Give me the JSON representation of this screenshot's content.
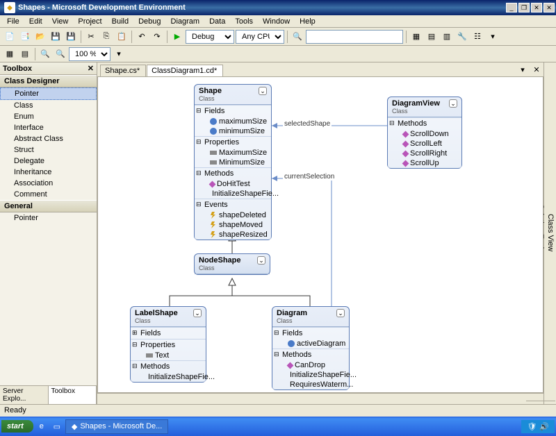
{
  "window": {
    "title": "Shapes - Microsoft Development Environment"
  },
  "menu": [
    "File",
    "Edit",
    "View",
    "Project",
    "Build",
    "Debug",
    "Diagram",
    "Data",
    "Tools",
    "Window",
    "Help"
  ],
  "toolbar": {
    "config": "Debug",
    "platform": "Any CPU",
    "zoom": "100 %"
  },
  "toolbox": {
    "title": "Toolbox",
    "sections": [
      {
        "name": "Class Designer",
        "items": [
          "Pointer",
          "Class",
          "Enum",
          "Interface",
          "Abstract Class",
          "Struct",
          "Delegate",
          "Inheritance",
          "Association",
          "Comment"
        ]
      },
      {
        "name": "General",
        "items": [
          "Pointer"
        ]
      }
    ],
    "tabs": [
      "Server Explo...",
      "Toolbox"
    ]
  },
  "tabs": [
    {
      "label": "Shape.cs*",
      "active": false
    },
    {
      "label": "ClassDiagram1.cd*",
      "active": true
    }
  ],
  "classes": {
    "shape": {
      "name": "Shape",
      "stereo": "Class",
      "sections": [
        {
          "title": "Fields",
          "kind": "field",
          "members": [
            "maximumSize",
            "minimumSize"
          ]
        },
        {
          "title": "Properties",
          "kind": "prop",
          "members": [
            "MaximumSize",
            "MinimumSize"
          ]
        },
        {
          "title": "Methods",
          "kind": "method",
          "members": [
            "DoHitTest",
            "InitializeShapeFie..."
          ]
        },
        {
          "title": "Events",
          "kind": "event",
          "members": [
            "shapeDeleted",
            "shapeMoved",
            "shapeResized"
          ]
        }
      ]
    },
    "diagramview": {
      "name": "DiagramView",
      "stereo": "Class",
      "sections": [
        {
          "title": "Methods",
          "kind": "method",
          "members": [
            "ScrollDown",
            "ScrollLeft",
            "ScrollRight",
            "ScrollUp"
          ]
        }
      ]
    },
    "nodeshape": {
      "name": "NodeShape",
      "stereo": "Class",
      "sections": []
    },
    "labelshape": {
      "name": "LabelShape",
      "stereo": "Class",
      "sections": [
        {
          "title": "Fields",
          "kind": "field",
          "members": [],
          "collapsed": true
        },
        {
          "title": "Properties",
          "kind": "prop",
          "members": [
            "Text"
          ]
        },
        {
          "title": "Methods",
          "kind": "method",
          "members": [
            "InitializeShapeFie..."
          ]
        }
      ]
    },
    "diagram": {
      "name": "Diagram",
      "stereo": "Class",
      "sections": [
        {
          "title": "Fields",
          "kind": "field",
          "members": [
            "activeDiagram"
          ]
        },
        {
          "title": "Methods",
          "kind": "method",
          "members": [
            "CanDrop",
            "InitializeShapeFie...",
            "RequiresWaterm..."
          ]
        }
      ]
    }
  },
  "associations": {
    "selectedShape": "selectedShape",
    "currentSelection": "currentSelection"
  },
  "sidetabs": [
    "Class View",
    "Solution Explorer",
    "Properties"
  ],
  "status": "Ready",
  "taskbar": {
    "start": "start",
    "app": "Shapes - Microsoft De..."
  }
}
